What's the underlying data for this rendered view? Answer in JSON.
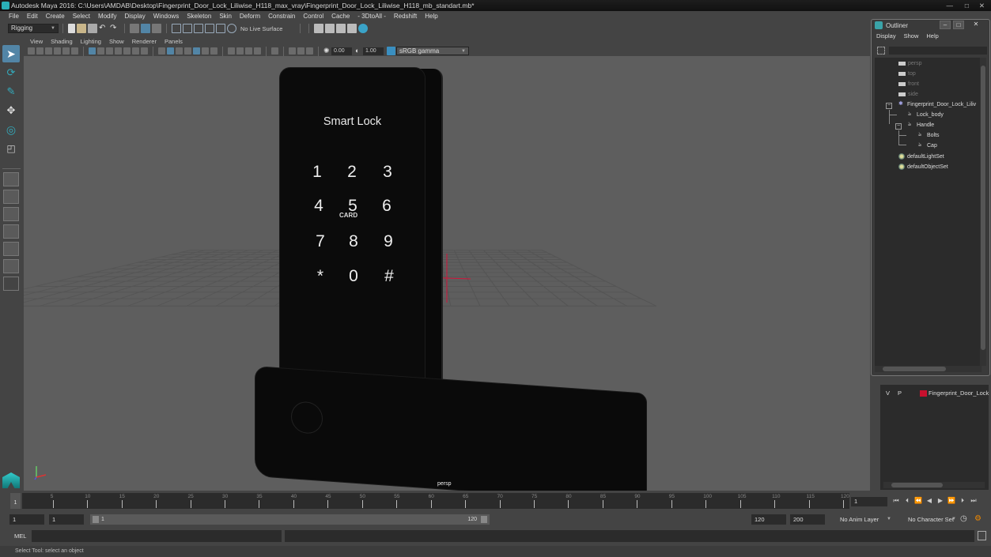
{
  "window": {
    "title": "Autodesk Maya 2016: C:\\Users\\AMDAB\\Desktop\\Fingerprint_Door_Lock_Liliwise_H118_max_vray\\Fingerprint_Door_Lock_Liliwise_H118_mb_standart.mb*"
  },
  "menubar": [
    "File",
    "Edit",
    "Create",
    "Select",
    "Modify",
    "Display",
    "Windows",
    "Skeleton",
    "Skin",
    "Deform",
    "Constrain",
    "Control",
    "Cache",
    "- 3DtoAll -",
    "Redshift",
    "Help"
  ],
  "shelf": {
    "mode": "Rigging",
    "live_surface": "No Live Surface"
  },
  "panel": {
    "menu": [
      "View",
      "Shading",
      "Lighting",
      "Show",
      "Renderer",
      "Panels"
    ],
    "exposure": "0.00",
    "gamma": "1.00",
    "color_space": "sRGB gamma",
    "camera_label": "persp"
  },
  "model": {
    "title": "Smart Lock",
    "keys": [
      "1",
      "2",
      "3",
      "4",
      "5",
      "6",
      "7",
      "8",
      "9",
      "*",
      "0",
      "#"
    ],
    "card_label": "CARD"
  },
  "outliner": {
    "title": "Outliner",
    "menu": [
      "Display",
      "Show",
      "Help"
    ],
    "cameras": [
      "persp",
      "top",
      "front",
      "side"
    ],
    "root": "Fingerprint_Door_Lock_Liliv",
    "children": [
      "Lock_body",
      "Handle"
    ],
    "handle_children": [
      "Bolts",
      "Cap"
    ],
    "sets": [
      "defaultLightSet",
      "defaultObjectSet"
    ]
  },
  "layers": {
    "visible_flag": "V",
    "playback_flag": "P",
    "layer_name": "Fingerprint_Door_Lock",
    "layer_color": "#c8102e"
  },
  "timeline": {
    "ticks": [
      "5",
      "10",
      "15",
      "20",
      "25",
      "30",
      "35",
      "40",
      "45",
      "50",
      "55",
      "60",
      "65",
      "70",
      "75",
      "80",
      "85",
      "90",
      "95",
      "100",
      "105",
      "110",
      "115",
      "120"
    ],
    "current_frame": "1",
    "frame_field": "1"
  },
  "range": {
    "start": "1",
    "playback_start": "1",
    "slider_start": "1",
    "slider_end": "120",
    "playback_end": "120",
    "end": "200",
    "anim_layer": "No Anim Layer",
    "character_set": "No Character Set"
  },
  "command": {
    "mode": "MEL"
  },
  "help_line": "Select Tool: select an object"
}
